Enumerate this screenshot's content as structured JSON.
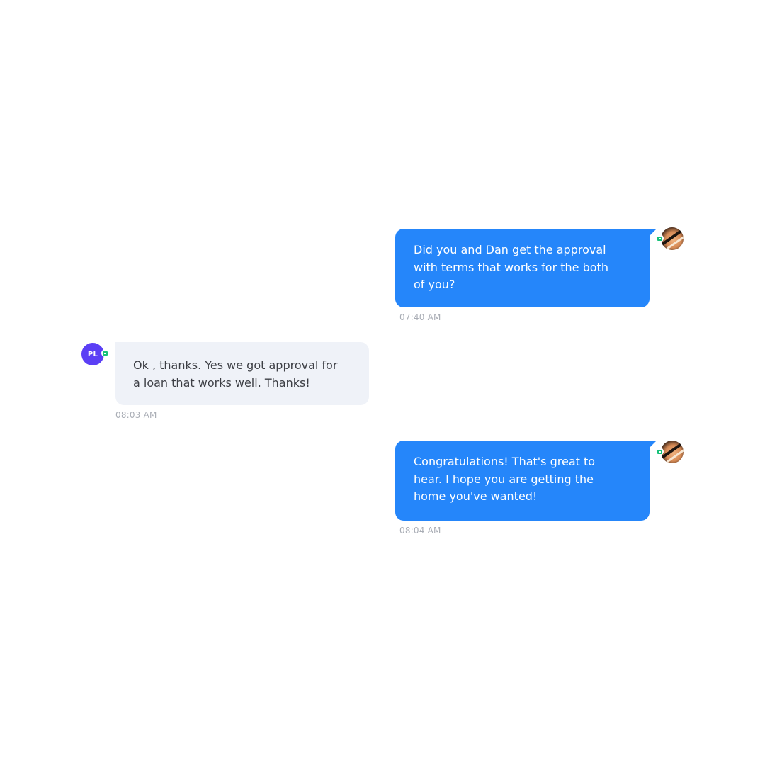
{
  "conversation": {
    "messages": [
      {
        "direction": "outgoing",
        "text": "Did you and Dan get the approval\nwith terms that works for the both\nof you?",
        "time": "07:40 AM",
        "avatar_icon": "user-photo-avatar",
        "channel_icon": "sms-channel-icon"
      },
      {
        "direction": "incoming",
        "text": "Ok , thanks. Yes we got approval for\na loan that works well. Thanks!",
        "time": "08:03 AM",
        "avatar_initials": "PL",
        "channel_icon": "sms-channel-icon"
      },
      {
        "direction": "outgoing",
        "text": "Congratulations! That's great to\nhear. I hope you are getting the\nhome you've wanted!",
        "time": "08:04 AM",
        "avatar_icon": "user-photo-avatar",
        "channel_icon": "sms-channel-icon"
      }
    ]
  },
  "colors": {
    "outgoing_bubble": "#2586fa",
    "incoming_bubble": "#eff2f8",
    "incoming_avatar": "#5b3ff5",
    "channel_badge": "#18c27a",
    "timestamp": "#a9adb5"
  }
}
